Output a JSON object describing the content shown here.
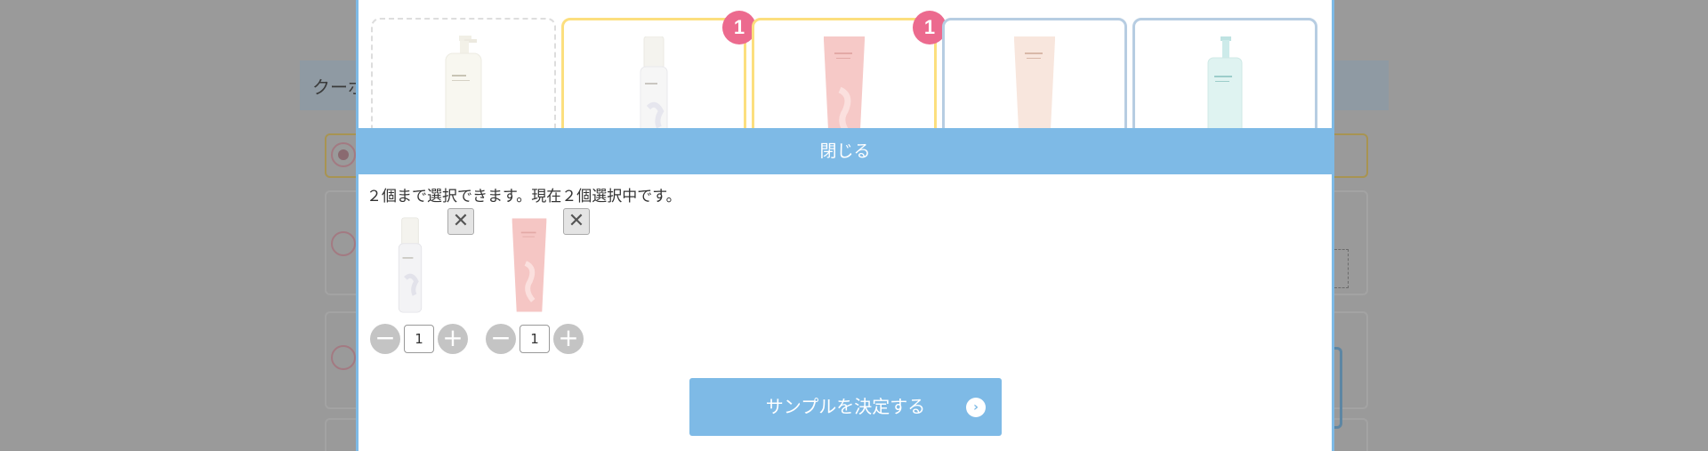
{
  "background": {
    "bar_text": "クーポ"
  },
  "tiles": [
    {
      "state": "dashed",
      "badge": "",
      "product": "pump-bottle"
    },
    {
      "state": "picked",
      "badge": "1",
      "product": "foam-bottle"
    },
    {
      "state": "picked",
      "badge": "1",
      "product": "pink-tube"
    },
    {
      "state": "normal",
      "badge": "",
      "product": "beige-tube"
    },
    {
      "state": "normal",
      "badge": "",
      "product": "mint-pump"
    }
  ],
  "close_label": "閉じる",
  "info_text": "２個まで選択できます。現在２個選択中です。",
  "selected": [
    {
      "product": "foam-bottle",
      "quantity": "1",
      "remove_icon": "close-icon"
    },
    {
      "product": "pink-tube",
      "quantity": "1",
      "remove_icon": "close-icon"
    }
  ],
  "stepper": {
    "minus": "−",
    "plus": "+"
  },
  "remove_glyph": "✕",
  "confirm_label": "サンプルを決定する",
  "confirm_arrow": "›",
  "colors": {
    "accent": "#7ebae6",
    "badge": "#ec6a8e",
    "picked_border": "#fcdf7e",
    "tile_border": "#b7cde2"
  }
}
